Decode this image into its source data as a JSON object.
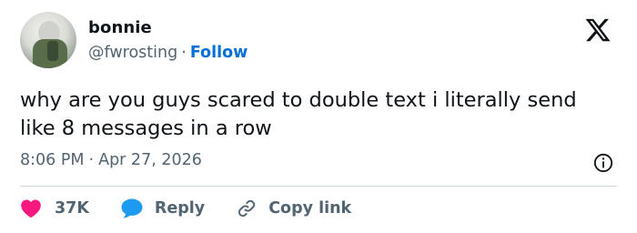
{
  "author": {
    "name": "bonnie",
    "handle": "@fwrosting",
    "separator": "·",
    "follow_label": "Follow"
  },
  "tweet": {
    "text": "why are you guys scared to double text i literally send like 8 messages in a row",
    "time": "8:06 PM",
    "date": "Apr 27, 2026",
    "separator": "·"
  },
  "actions": {
    "likes": "37K",
    "reply_label": "Reply",
    "copy_link_label": "Copy link"
  },
  "icons": {
    "logo": "x-logo-icon",
    "info": "info-icon",
    "like": "heart-icon",
    "reply": "speech-bubble-icon",
    "copy": "link-icon"
  },
  "colors": {
    "accent": "#006fd6",
    "heart": "#f91880",
    "reply_bubble": "#1d9bf0",
    "muted": "#536471",
    "text": "#0f1419"
  }
}
